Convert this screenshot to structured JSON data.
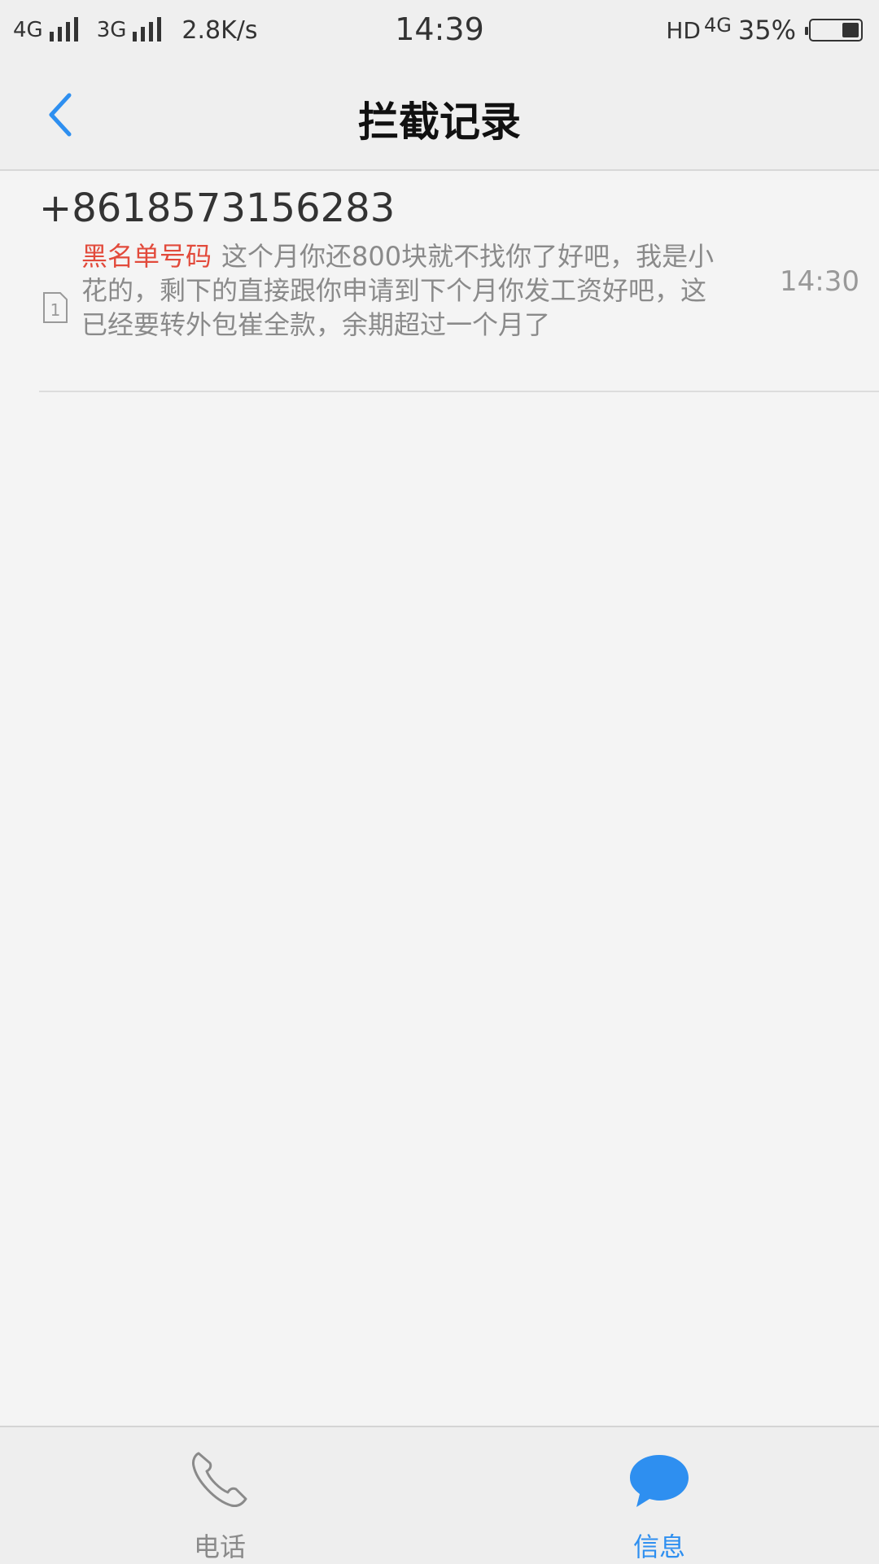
{
  "status_bar": {
    "network1": "4G",
    "network2": "3G",
    "speed": "2.8K/s",
    "clock": "14:39",
    "hd": "HD",
    "network_right": "4G",
    "battery_percent": "35%",
    "battery_level": 0.35
  },
  "header": {
    "title": "拦截记录"
  },
  "messages": [
    {
      "sender": "+8618573156283",
      "tag": "黑名单号码",
      "body": "这个月你还800块就不找你了好吧，我是小花的，剩下的直接跟你申请到下个月你发工资好吧，这已经要转外包崔全款，余期超过一个月了",
      "time": "14:30",
      "sim": "1"
    }
  ],
  "bottom_nav": {
    "tabs": [
      {
        "label": "电话",
        "active": false
      },
      {
        "label": "信息",
        "active": true
      }
    ]
  },
  "colors": {
    "accent": "#2e8ff0",
    "blacklist_red": "#e24a3b",
    "background": "#f4f4f4"
  },
  "icons": {
    "back": "chevron-left-icon",
    "sim": "sim-card-icon",
    "phone": "phone-icon",
    "messages": "chat-bubble-icon"
  }
}
